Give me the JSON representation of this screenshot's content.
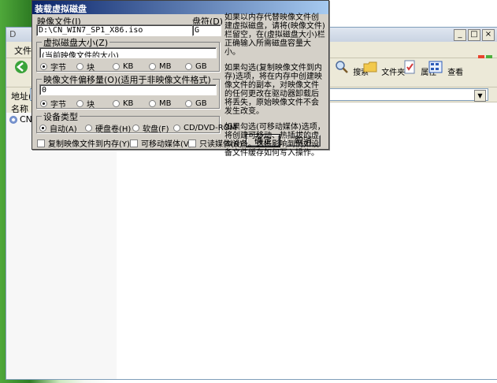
{
  "dialog": {
    "title": "装载虚拟磁盘",
    "image_file_label": "映像文件(I)",
    "image_file_value": "D:\\CN_WIN7_SP1_X86.iso",
    "browse_label": "...",
    "drive_label": "盘符(D)",
    "drive_value": "G",
    "size_group": {
      "title": "虚拟磁盘大小(Z)",
      "value": "(当前映像文件的大小)",
      "units": [
        "字节",
        "块",
        "KB",
        "MB",
        "GB"
      ],
      "selected": "字节"
    },
    "offset_group": {
      "title": "映像文件偏移量(O)(适用于非映像文件格式)",
      "value": "0",
      "units": [
        "字节",
        "块",
        "KB",
        "MB",
        "GB"
      ],
      "selected": "字节"
    },
    "device_group": {
      "title": "设备类型",
      "options": [
        "自动(A)",
        "硬盘卷(H)",
        "软盘(F)",
        "CD/DVD-ROM"
      ],
      "selected": "自动(A)"
    },
    "checks": [
      "复制映像文件到内存(Y)",
      "可移动媒体(V)",
      "只读媒体(R)"
    ],
    "ok_label": "确定",
    "cancel_label": "取消",
    "help": [
      "如果以内存代替映像文件创建虚拟磁盘，请将(映像文件)栏留空，在(虚拟磁盘大小)栏正确输入所需磁盘容量大小。",
      "如果勾选(复制映像文件到内存)选项，将在内存中创建映像文件的副本，对映像文件的任何更改在驱动器卸载后将丢失，原始映像文件不会发生改变。",
      "如果勾选(可移动媒体)选项，将创建可移动、热插拔的虚拟设备。这将影响到例如设备文件缓存如何写入操作。"
    ]
  },
  "explorer": {
    "title": "D",
    "menu_file": "文件(",
    "back_label": "后退",
    "search_label": "搜索",
    "folders_label": "文件夹",
    "properties_label": "属性",
    "view_label": "查看",
    "address_label": "地址(",
    "column_name": "名称",
    "item_label": "CN"
  }
}
